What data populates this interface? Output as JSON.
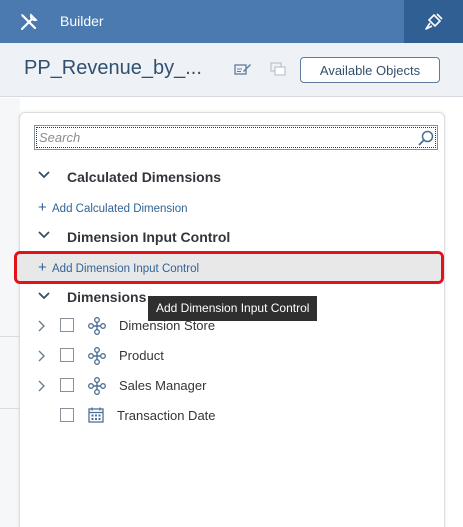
{
  "topbar": {
    "title": "Builder",
    "tools_icon": "tools-icon",
    "right_icon": "brush-icon"
  },
  "header": {
    "doc_title": "PP_Revenue_by_...",
    "icons": [
      "edit-formula-icon",
      "copy-icon"
    ],
    "available_objects_label": "Available Objects"
  },
  "search": {
    "placeholder": "Search"
  },
  "sections": [
    {
      "title": "Calculated Dimensions",
      "add_label": "Add Calculated Dimension"
    },
    {
      "title": "Dimension Input Control",
      "add_label": "Add Dimension Input Control"
    },
    {
      "title": "Dimensions"
    }
  ],
  "tooltip": {
    "text": "Add Dimension Input Control"
  },
  "dimensions": [
    {
      "label": "Dimension Store",
      "icon": "hierarchy-icon",
      "expandable": true
    },
    {
      "label": "Product",
      "icon": "hierarchy-icon",
      "expandable": true
    },
    {
      "label": "Sales Manager",
      "icon": "hierarchy-icon",
      "expandable": true
    },
    {
      "label": "Transaction Date",
      "icon": "calendar-icon",
      "expandable": false
    }
  ],
  "colors": {
    "header_blue": "#4a7ab0",
    "header_dark": "#2f5f93",
    "link_blue": "#2f6497",
    "highlight_red": "#e2121b"
  }
}
